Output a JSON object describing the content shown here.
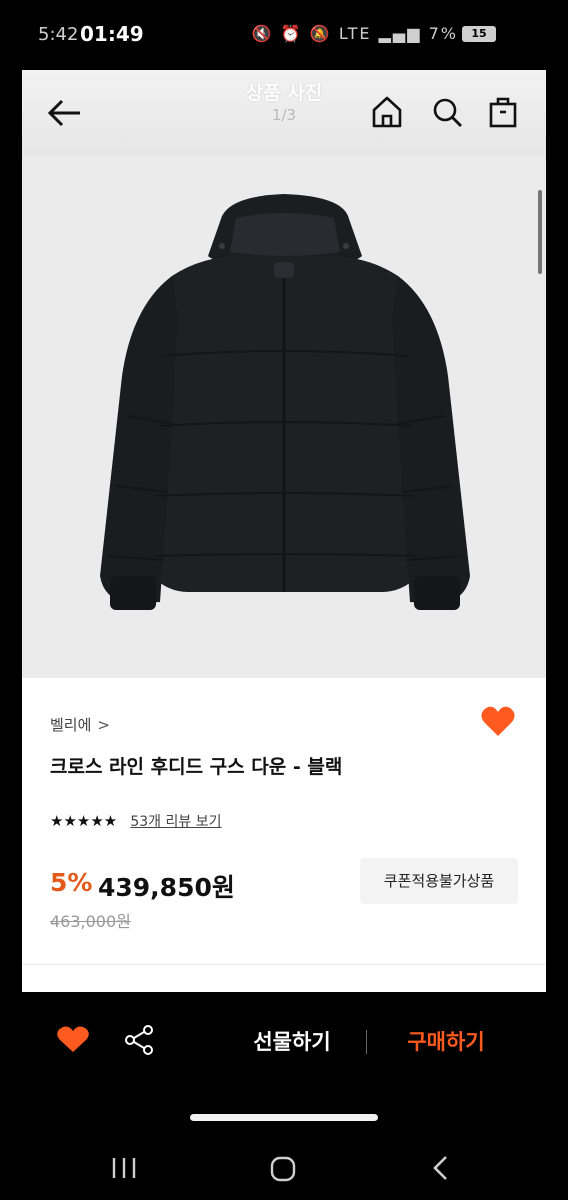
{
  "status": {
    "time": "5:42",
    "overlay_time": "01:49",
    "icons": "🔇 ⏰ 🔕 LTE ▂▄▆ 7%",
    "battery": "15"
  },
  "viewer": {
    "title": "상품 사진",
    "counter": "1/3"
  },
  "app_header": {
    "title": "상품 사진",
    "counter": "1/3"
  },
  "product": {
    "brand": "벨리에",
    "brand_chevron": ">",
    "name": "크로스 라인 후디드 구스 다운 - 블랙",
    "stars": "★★★★★",
    "review_link": "53개 리뷰 보기",
    "discount": "5%",
    "price": "439,850원",
    "original_price": "463,000원",
    "coupon_label": "쿠폰적용불가상품"
  },
  "bottom_bar": {
    "gift_label": "선물하기",
    "buy_label": "구매하기"
  },
  "colors": {
    "accent": "#ff5b1f",
    "discount": "#e35a19",
    "heart": "#ff5a1f"
  }
}
